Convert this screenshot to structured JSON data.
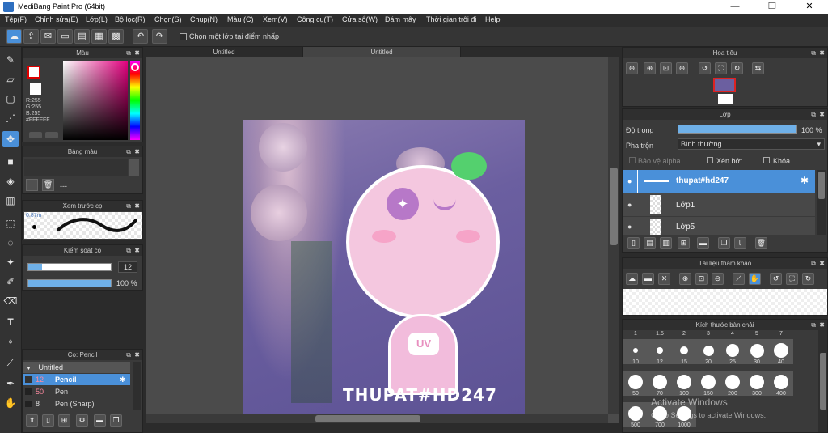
{
  "window": {
    "title": "MediBang Paint Pro (64bit)",
    "minimize": "—",
    "maximize": "❐",
    "close": "✕"
  },
  "menu": [
    "Tệp(F)",
    "Chỉnh sửa(E)",
    "Lớp(L)",
    "Bộ lọc(R)",
    "Chọn(S)",
    "Chụp(N)",
    "Màu (C)",
    "Xem(V)",
    "Công cụ(T)",
    "Cửa sổ(W)",
    "Đám mây",
    "Thời gian trôi đi",
    "Help"
  ],
  "toolbar": {
    "checkbox_label": "Chọn một lớp tại điểm nhấp"
  },
  "color_panel": {
    "title": "Màu",
    "r": "R:255",
    "g": "G:255",
    "b": "B:255",
    "hex": "#FFFFFF"
  },
  "palette_panel": {
    "title": "Bảng màu",
    "value": "---"
  },
  "brush_preview_panel": {
    "title": "Xem trước cọ",
    "size": "0.87m"
  },
  "brush_control_panel": {
    "title": "Kiểm soát cọ",
    "size_value": "12",
    "opacity_value": "100 %",
    "size_level": 0.17,
    "opacity_level": 1.0
  },
  "brush_list_panel": {
    "title": "Cọ: Pencil",
    "group": "Untitled",
    "items": [
      {
        "size": "12",
        "name": "Pencil",
        "selected": true
      },
      {
        "size": "50",
        "name": "Pen",
        "selected": false
      },
      {
        "size": "8",
        "name": "Pen (Sharp)",
        "selected": false
      }
    ]
  },
  "canvas_tabs": [
    "Untitled",
    "Untitled"
  ],
  "canvas": {
    "artwork_caption": "THUPAT#HD247",
    "mascot_text": "UV"
  },
  "navigator_panel": {
    "title": "Hoa tiêu"
  },
  "layer_panel": {
    "title": "Lớp",
    "opacity_label": "Độ trong",
    "opacity_value": "100 %",
    "opacity_level": 1.0,
    "blend_label": "Pha trộn",
    "blend_value": "Bình thường",
    "protect_alpha": "Bảo vệ alpha",
    "clipping": "Xén bớt",
    "lock": "Khóa",
    "layers": [
      {
        "name": "thupat#hd247",
        "selected": true
      },
      {
        "name": "Lớp1",
        "selected": false
      },
      {
        "name": "Lớp5",
        "selected": false
      }
    ]
  },
  "reference_panel": {
    "title": "Tài liệu tham khảo"
  },
  "brush_size_panel": {
    "title": "Kích thước bàn chải",
    "top_labels": [
      "1",
      "1.5",
      "2",
      "3",
      "4",
      "5",
      "7"
    ],
    "row1": [
      "10",
      "12",
      "15",
      "20",
      "25",
      "30",
      "40"
    ],
    "row2": [
      "50",
      "70",
      "100",
      "150",
      "200",
      "300",
      "400"
    ],
    "row3": [
      "500",
      "700",
      "1000"
    ]
  },
  "watermark": {
    "line1": "Activate Windows",
    "line2": "Go to Settings to activate Windows."
  },
  "colors": {
    "accent": "#4a90d9",
    "panel": "#3a3a3a",
    "canvas_bg": "#6b5fa0",
    "mascot_pink": "#f2bcdc"
  }
}
